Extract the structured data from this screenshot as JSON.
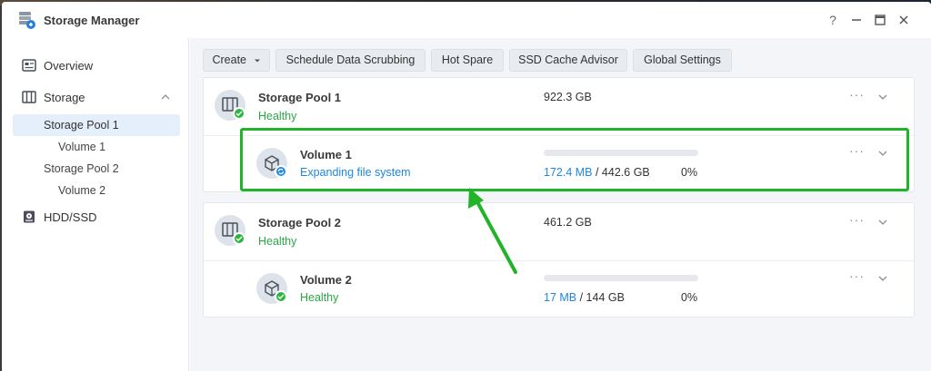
{
  "window": {
    "title": "Storage Manager"
  },
  "titlebar": {
    "help": "?",
    "minimize": "—",
    "maximize": "▭",
    "close": "✕"
  },
  "sidebar": {
    "items": [
      {
        "label": "Overview",
        "icon": "overview-icon"
      },
      {
        "label": "Storage",
        "icon": "storage-icon"
      },
      {
        "label": "HDD/SSD",
        "icon": "hdd-icon"
      }
    ],
    "storage_children": [
      {
        "label": "Storage Pool 1"
      },
      {
        "label": "Volume 1"
      },
      {
        "label": "Storage Pool 2"
      },
      {
        "label": "Volume 2"
      }
    ]
  },
  "toolbar": {
    "create": "Create",
    "scrub": "Schedule Data Scrubbing",
    "hot_spare": "Hot Spare",
    "ssd_cache": "SSD Cache Advisor",
    "global_settings": "Global Settings"
  },
  "pools": [
    {
      "name": "Storage Pool 1",
      "status": "Healthy",
      "size": "922.3 GB",
      "volume": {
        "name": "Volume 1",
        "status": "Expanding file system",
        "used": "172.4 MB",
        "total": " / 442.6 GB",
        "percent": "0%",
        "fill": 0
      }
    },
    {
      "name": "Storage Pool 2",
      "status": "Healthy",
      "size": "461.2 GB",
      "volume": {
        "name": "Volume 2",
        "status": "Healthy",
        "used": "17 MB",
        "total": " / 144 GB",
        "percent": "0%",
        "fill": 0
      }
    }
  ],
  "more_label": "···",
  "colors": {
    "accent": "#1e86e0",
    "healthy": "#2aa745",
    "annotation": "#21b32a"
  }
}
